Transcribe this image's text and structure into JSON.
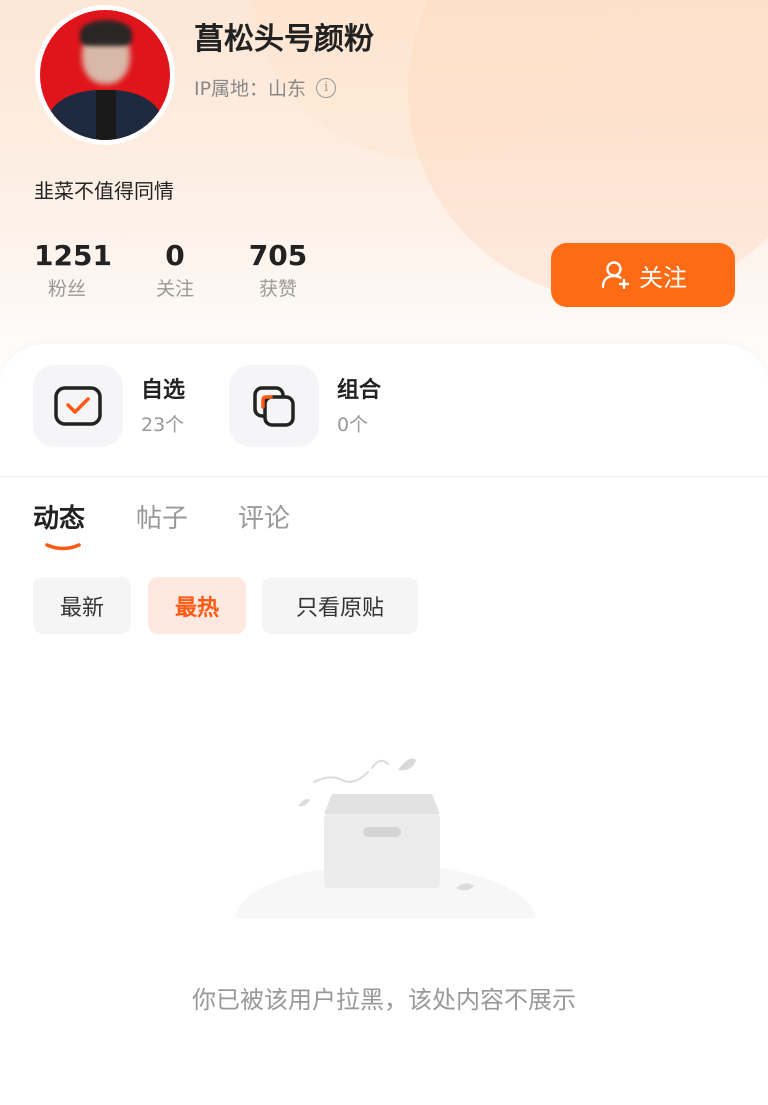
{
  "profile": {
    "name": "菖松头号颜粉",
    "ip_label": "IP属地：山东",
    "bio": "韭菜不值得同情"
  },
  "stats": [
    {
      "value": "1251",
      "label": "粉丝"
    },
    {
      "value": "0",
      "label": "关注"
    },
    {
      "value": "705",
      "label": "获赞"
    }
  ],
  "follow_button": {
    "label": "关注",
    "color": "#ff6b15"
  },
  "tiles": [
    {
      "title": "自选",
      "count": "23个",
      "icon": "checklist-icon"
    },
    {
      "title": "组合",
      "count": "0个",
      "icon": "portfolio-icon"
    }
  ],
  "tabs": [
    {
      "label": "动态",
      "active": true
    },
    {
      "label": "帖子",
      "active": false
    },
    {
      "label": "评论",
      "active": false
    }
  ],
  "filters": [
    {
      "label": "最新",
      "active": false
    },
    {
      "label": "最热",
      "active": true
    },
    {
      "label": "只看原贴",
      "active": false
    }
  ],
  "empty_state": {
    "message": "你已被该用户拉黑，该处内容不展示",
    "icon": "empty-box-icon"
  },
  "colors": {
    "accent": "#ff6b15",
    "text": "#222222",
    "muted": "#999999"
  }
}
